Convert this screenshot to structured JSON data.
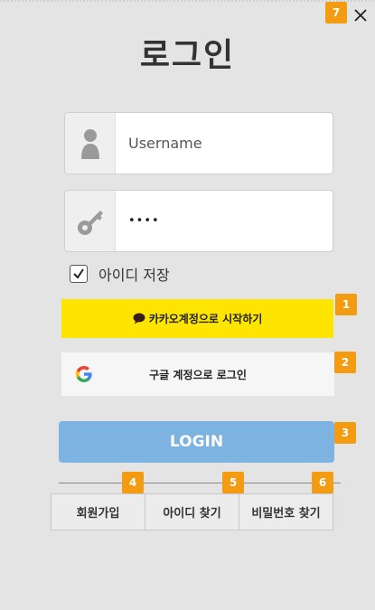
{
  "window": {
    "title": "로그인",
    "close_label": "×"
  },
  "form": {
    "username_placeholder": "Username",
    "password_value": "••••",
    "remember_label": "아이디 저장",
    "remember_checked": true
  },
  "buttons": {
    "kakao_label": "카카오계정으로 시작하기",
    "google_label": "구글 계정으로 로그인",
    "login_label": "LOGIN"
  },
  "links": [
    {
      "label": "회원가입"
    },
    {
      "label": "아이디 찾기"
    },
    {
      "label": "비밀번호 찾기"
    }
  ],
  "badges": [
    "1",
    "2",
    "3",
    "4",
    "5",
    "6",
    "7"
  ],
  "colors": {
    "background": "#e4e4e4",
    "kakao": "#fee500",
    "login": "#7cb3e0",
    "badge": "#f39c12"
  },
  "icons": {
    "username": "person-icon",
    "password": "key-icon",
    "kakao": "speech-bubble-icon",
    "google": "google-g-icon",
    "close": "close-icon"
  }
}
